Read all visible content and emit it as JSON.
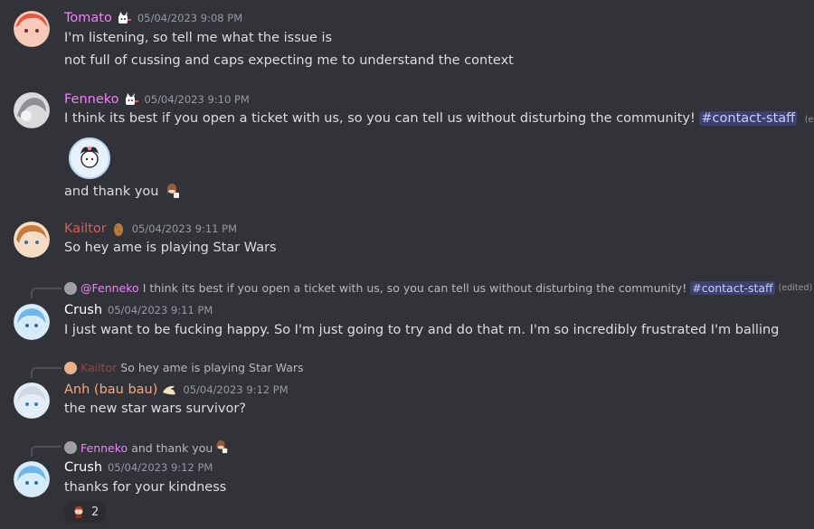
{
  "colors": {
    "background": "#313338",
    "tomato": "#f47fff",
    "fenneko": "#f47fff",
    "kailtor": "#e05a57",
    "crush": "#ffffff",
    "anh": "#f5a97f",
    "mention_bg": "#3c4270"
  },
  "messages": [
    {
      "author": "Tomato",
      "badge_icon": "cat-sticker-icon",
      "timestamp": "05/04/2023 9:08 PM",
      "lines": [
        "I'm listening, so tell me what the issue is",
        "not full of cussing and caps expecting me to understand the context"
      ]
    },
    {
      "author": "Fenneko",
      "badge_icon": "cat-sticker-icon",
      "timestamp": "05/04/2023 9:10 PM",
      "line1_text": "I think its best if you open a ticket with us, so you can tell us without disturbing the community!",
      "line1_mention": "#contact-staff",
      "line1_edited": "(edited)",
      "sticker_icon": "kuromi-sticker-icon",
      "line2": "and thank you"
    },
    {
      "author": "Kailtor",
      "badge_icon": "potato-icon",
      "timestamp": "05/04/2023 9:11 PM",
      "lines": [
        "So hey ame is playing Star Wars"
      ]
    },
    {
      "reply_author": "@Fenneko",
      "reply_text": "I think its best if you open a ticket with us, so you can tell us without disturbing the community!",
      "reply_mention": "#contact-staff",
      "reply_edited": "(edited)",
      "author": "Crush",
      "timestamp": "05/04/2023 9:11 PM",
      "lines": [
        "I just want to be fucking happy. So I'm just going to try and do that rn. I'm so incredibly frustrated I'm balling"
      ]
    },
    {
      "reply_author": "Kailtor",
      "reply_text": "So hey ame is playing Star Wars",
      "author": "Anh (bau bau)",
      "badge_icon": "shark-icon",
      "timestamp": "05/04/2023 9:12 PM",
      "lines": [
        "the new star wars survivor?"
      ]
    },
    {
      "reply_author": "Fenneko",
      "reply_text": "and thank you",
      "author": "Crush",
      "timestamp": "05/04/2023 9:12 PM",
      "lines": [
        "thanks for your kindness"
      ],
      "reaction_icon": "anime-girl-emoji-icon",
      "reaction_count": "2"
    }
  ]
}
